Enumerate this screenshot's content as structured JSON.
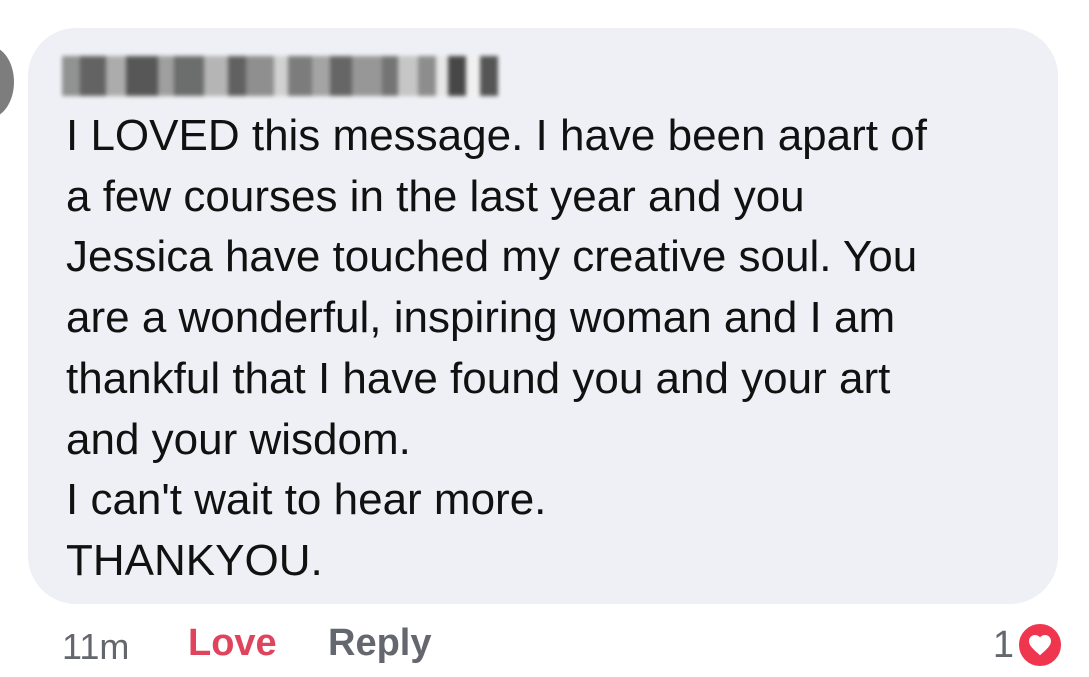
{
  "comment": {
    "author_name": "",
    "text": "I LOVED this message. I have been apart of\na few courses in the last year and you\nJessica have touched my creative soul. You\nare a wonderful, inspiring woman and I am\nthankful that I have found you and your art\nand your wisdom.\nI can't wait to hear more.\nTHANKYOU."
  },
  "footer": {
    "time": "11m",
    "love_label": "Love",
    "reply_label": "Reply",
    "reaction_count": "1",
    "reaction_icon": "heart-icon"
  },
  "colors": {
    "bubble_bg": "#eff0f5",
    "love": "#e0445d",
    "meta": "#64676d",
    "heart": "#f0364f"
  }
}
